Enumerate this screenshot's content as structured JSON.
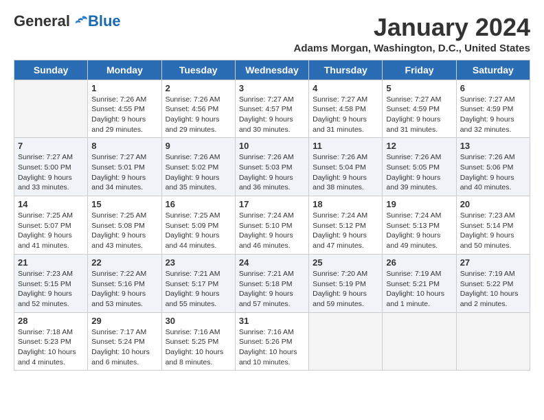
{
  "logo": {
    "general": "General",
    "blue": "Blue"
  },
  "title": "January 2024",
  "location": "Adams Morgan, Washington, D.C., United States",
  "days_of_week": [
    "Sunday",
    "Monday",
    "Tuesday",
    "Wednesday",
    "Thursday",
    "Friday",
    "Saturday"
  ],
  "weeks": [
    [
      {
        "day": "",
        "empty": true
      },
      {
        "day": "1",
        "sunrise": "7:26 AM",
        "sunset": "4:55 PM",
        "daylight": "9 hours and 29 minutes."
      },
      {
        "day": "2",
        "sunrise": "7:26 AM",
        "sunset": "4:56 PM",
        "daylight": "9 hours and 29 minutes."
      },
      {
        "day": "3",
        "sunrise": "7:27 AM",
        "sunset": "4:57 PM",
        "daylight": "9 hours and 30 minutes."
      },
      {
        "day": "4",
        "sunrise": "7:27 AM",
        "sunset": "4:58 PM",
        "daylight": "9 hours and 31 minutes."
      },
      {
        "day": "5",
        "sunrise": "7:27 AM",
        "sunset": "4:59 PM",
        "daylight": "9 hours and 31 minutes."
      },
      {
        "day": "6",
        "sunrise": "7:27 AM",
        "sunset": "4:59 PM",
        "daylight": "9 hours and 32 minutes."
      }
    ],
    [
      {
        "day": "7",
        "sunrise": "7:27 AM",
        "sunset": "5:00 PM",
        "daylight": "9 hours and 33 minutes."
      },
      {
        "day": "8",
        "sunrise": "7:27 AM",
        "sunset": "5:01 PM",
        "daylight": "9 hours and 34 minutes."
      },
      {
        "day": "9",
        "sunrise": "7:26 AM",
        "sunset": "5:02 PM",
        "daylight": "9 hours and 35 minutes."
      },
      {
        "day": "10",
        "sunrise": "7:26 AM",
        "sunset": "5:03 PM",
        "daylight": "9 hours and 36 minutes."
      },
      {
        "day": "11",
        "sunrise": "7:26 AM",
        "sunset": "5:04 PM",
        "daylight": "9 hours and 38 minutes."
      },
      {
        "day": "12",
        "sunrise": "7:26 AM",
        "sunset": "5:05 PM",
        "daylight": "9 hours and 39 minutes."
      },
      {
        "day": "13",
        "sunrise": "7:26 AM",
        "sunset": "5:06 PM",
        "daylight": "9 hours and 40 minutes."
      }
    ],
    [
      {
        "day": "14",
        "sunrise": "7:25 AM",
        "sunset": "5:07 PM",
        "daylight": "9 hours and 41 minutes."
      },
      {
        "day": "15",
        "sunrise": "7:25 AM",
        "sunset": "5:08 PM",
        "daylight": "9 hours and 43 minutes."
      },
      {
        "day": "16",
        "sunrise": "7:25 AM",
        "sunset": "5:09 PM",
        "daylight": "9 hours and 44 minutes."
      },
      {
        "day": "17",
        "sunrise": "7:24 AM",
        "sunset": "5:10 PM",
        "daylight": "9 hours and 46 minutes."
      },
      {
        "day": "18",
        "sunrise": "7:24 AM",
        "sunset": "5:12 PM",
        "daylight": "9 hours and 47 minutes."
      },
      {
        "day": "19",
        "sunrise": "7:24 AM",
        "sunset": "5:13 PM",
        "daylight": "9 hours and 49 minutes."
      },
      {
        "day": "20",
        "sunrise": "7:23 AM",
        "sunset": "5:14 PM",
        "daylight": "9 hours and 50 minutes."
      }
    ],
    [
      {
        "day": "21",
        "sunrise": "7:23 AM",
        "sunset": "5:15 PM",
        "daylight": "9 hours and 52 minutes."
      },
      {
        "day": "22",
        "sunrise": "7:22 AM",
        "sunset": "5:16 PM",
        "daylight": "9 hours and 53 minutes."
      },
      {
        "day": "23",
        "sunrise": "7:21 AM",
        "sunset": "5:17 PM",
        "daylight": "9 hours and 55 minutes."
      },
      {
        "day": "24",
        "sunrise": "7:21 AM",
        "sunset": "5:18 PM",
        "daylight": "9 hours and 57 minutes."
      },
      {
        "day": "25",
        "sunrise": "7:20 AM",
        "sunset": "5:19 PM",
        "daylight": "9 hours and 59 minutes."
      },
      {
        "day": "26",
        "sunrise": "7:19 AM",
        "sunset": "5:21 PM",
        "daylight": "10 hours and 1 minute."
      },
      {
        "day": "27",
        "sunrise": "7:19 AM",
        "sunset": "5:22 PM",
        "daylight": "10 hours and 2 minutes."
      }
    ],
    [
      {
        "day": "28",
        "sunrise": "7:18 AM",
        "sunset": "5:23 PM",
        "daylight": "10 hours and 4 minutes."
      },
      {
        "day": "29",
        "sunrise": "7:17 AM",
        "sunset": "5:24 PM",
        "daylight": "10 hours and 6 minutes."
      },
      {
        "day": "30",
        "sunrise": "7:16 AM",
        "sunset": "5:25 PM",
        "daylight": "10 hours and 8 minutes."
      },
      {
        "day": "31",
        "sunrise": "7:16 AM",
        "sunset": "5:26 PM",
        "daylight": "10 hours and 10 minutes."
      },
      {
        "day": "",
        "empty": true
      },
      {
        "day": "",
        "empty": true
      },
      {
        "day": "",
        "empty": true
      }
    ]
  ]
}
